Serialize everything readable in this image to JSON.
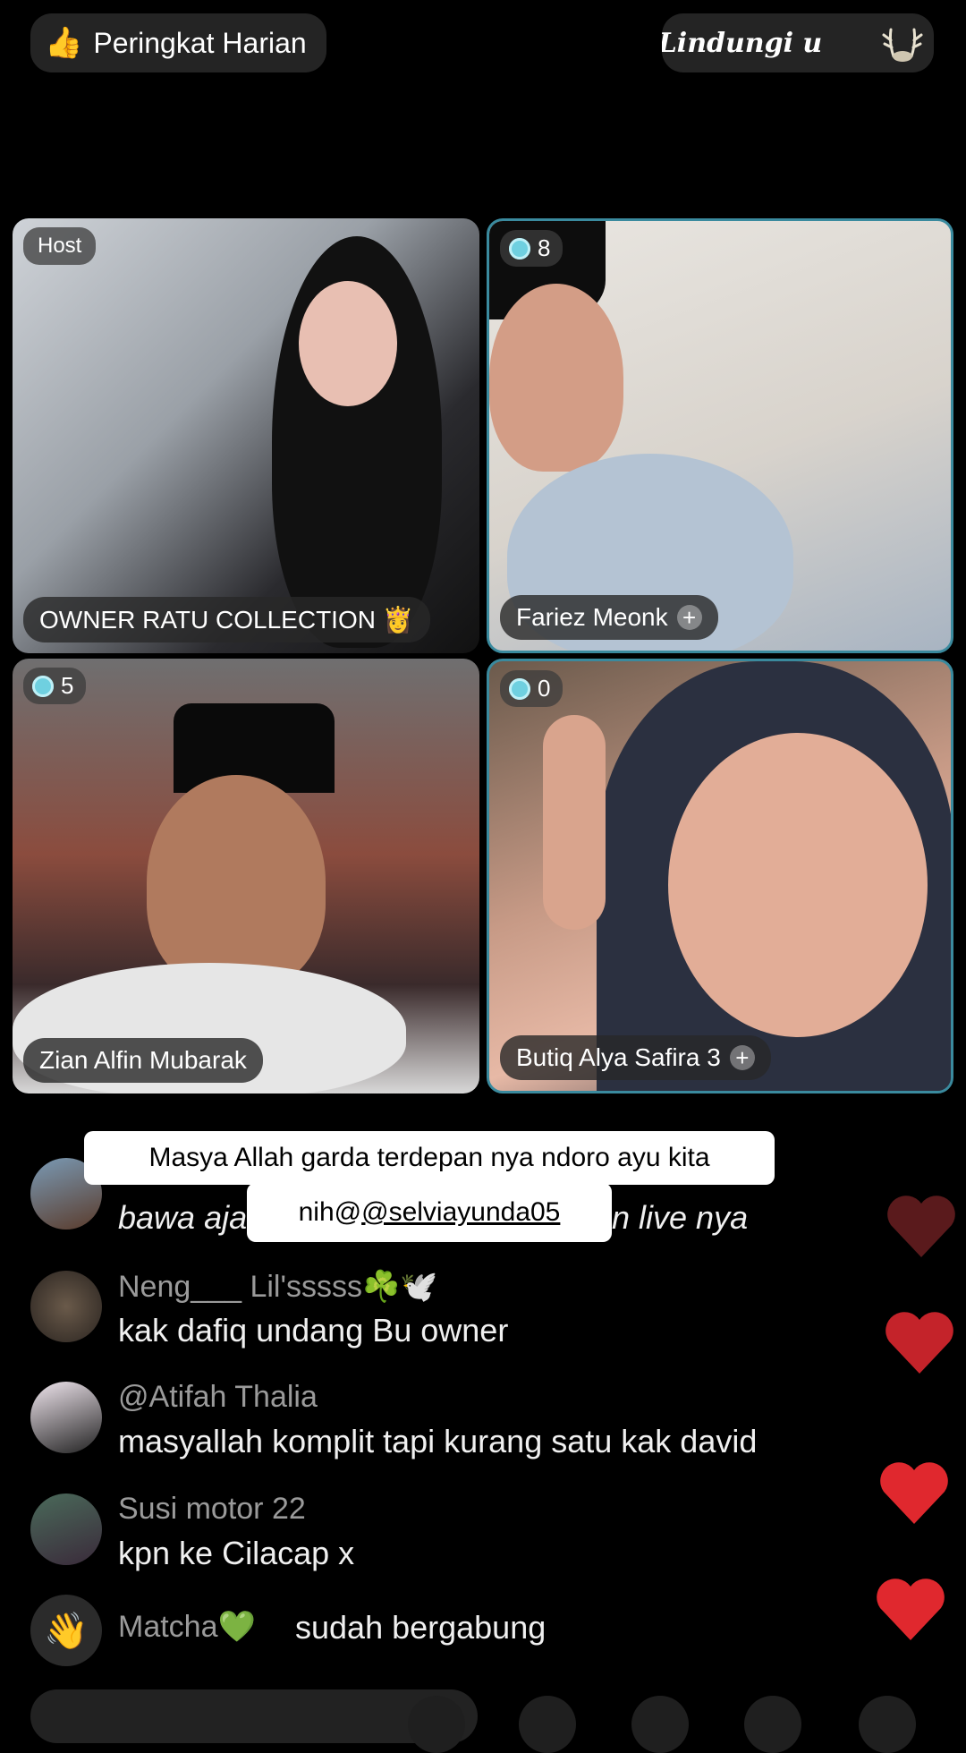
{
  "top": {
    "ranking_label": "Peringkat Harian",
    "ranking_icon": "thumb-icon",
    "scroll_text": "it  Lindungi u",
    "antler_icon": "antler-icon"
  },
  "tiles": [
    {
      "badge": "Host",
      "name": "OWNER RATU COLLECTION 👸"
    },
    {
      "count": "8",
      "name": "Fariez Meonk"
    },
    {
      "count": "5",
      "name": "Zian Alfin Mubarak"
    },
    {
      "count": "0",
      "name": "Butiq Alya Safira 3"
    }
  ],
  "caption": {
    "line1": "Masya Allah garda terdepan nya ndoro ayu kita",
    "line2_prefix": "nih@",
    "line2_handle": "@selviayunda05"
  },
  "comments": [
    {
      "name": "",
      "text_left": "bawa aja",
      "text_right": "n live nya"
    },
    {
      "name": "Neng___ Lil'sssss☘️🕊️",
      "text": "kak dafiq undang Bu owner"
    },
    {
      "name": "@Atifah Thalia",
      "text": "masyallah komplit tapi kurang satu kak david"
    },
    {
      "name": "Susi motor 22",
      "text": "kpn ke Cilacap x"
    }
  ],
  "join": {
    "name": "Matcha💚",
    "text": "sudah bergabung",
    "icon": "wave-hand-icon"
  },
  "colors": {
    "tile_border": "#3a8a9e",
    "heart": "#e0282e",
    "heart_faded": "#5a1a1c"
  }
}
